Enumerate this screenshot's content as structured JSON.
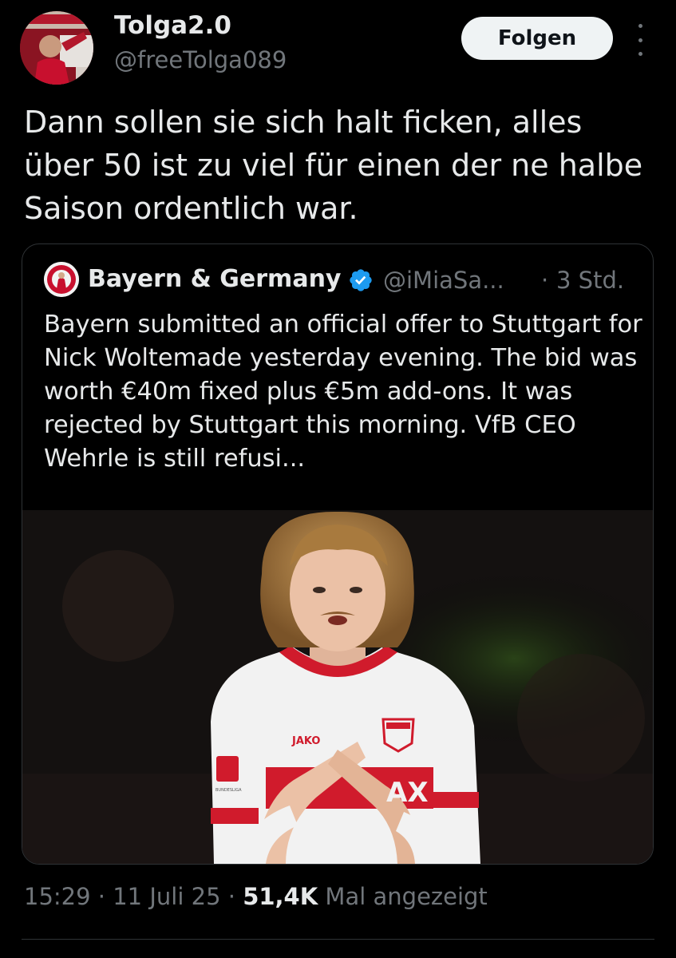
{
  "author": {
    "display_name": "Tolga2.0",
    "handle": "@freeTolga089",
    "avatar_icon": "profile-photo"
  },
  "header": {
    "follow_label": "Folgen",
    "more_icon": "more-vertical-icon"
  },
  "tweet": {
    "text": "Dann sollen sie sich halt ficken, alles über 50 ist zu viel für einen der ne halbe Saison ordentlich war."
  },
  "quoted": {
    "display_name": "Bayern & Germany",
    "verified": true,
    "handle": "@iMiaSa...",
    "separator": "·",
    "time": "3 Std.",
    "text": "Bayern submitted an official offer to Stuttgart for Nick Woltemade yesterday evening. The bid was worth €40m fixed plus €5m add-ons. It was rejected by Stuttgart this morning. VfB CEO Wehrle is still refusi...",
    "media_kit_text": "JAKO",
    "media_sponsor_text": "AX",
    "media_league_text": "BUNDESLIGA"
  },
  "meta": {
    "time": "15:29",
    "sep1": " · ",
    "date": "11 Juli 25",
    "sep2": " · ",
    "views": "51,4K",
    "views_label": " Mal angezeigt"
  },
  "colors": {
    "background": "#000000",
    "primary_text": "#e7e9ea",
    "secondary_text": "#71767b",
    "verified_blue": "#1d9bf0",
    "follow_button_bg": "#eff3f4",
    "border": "#2f3336"
  }
}
